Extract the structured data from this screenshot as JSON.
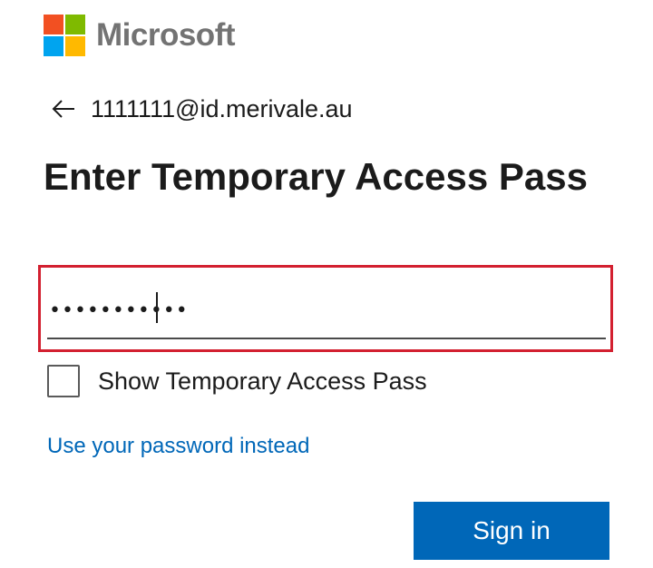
{
  "brand": {
    "name": "Microsoft",
    "colors": {
      "red": "#f25022",
      "green": "#7fba00",
      "blue": "#00a4ef",
      "yellow": "#ffb900",
      "text": "#737373"
    }
  },
  "identity": {
    "back_icon": "arrow-left-icon",
    "account": "1111111@id.merivale.au"
  },
  "title": "Enter Temporary Access Pass",
  "pass_field": {
    "value": "•••••••••••",
    "type": "password"
  },
  "show_pass": {
    "label": "Show Temporary Access Pass",
    "checked": false
  },
  "alt_link": {
    "label": "Use your password instead"
  },
  "signin_button": {
    "label": "Sign in",
    "color": "#0067b8"
  },
  "highlight_color": "#d32030"
}
